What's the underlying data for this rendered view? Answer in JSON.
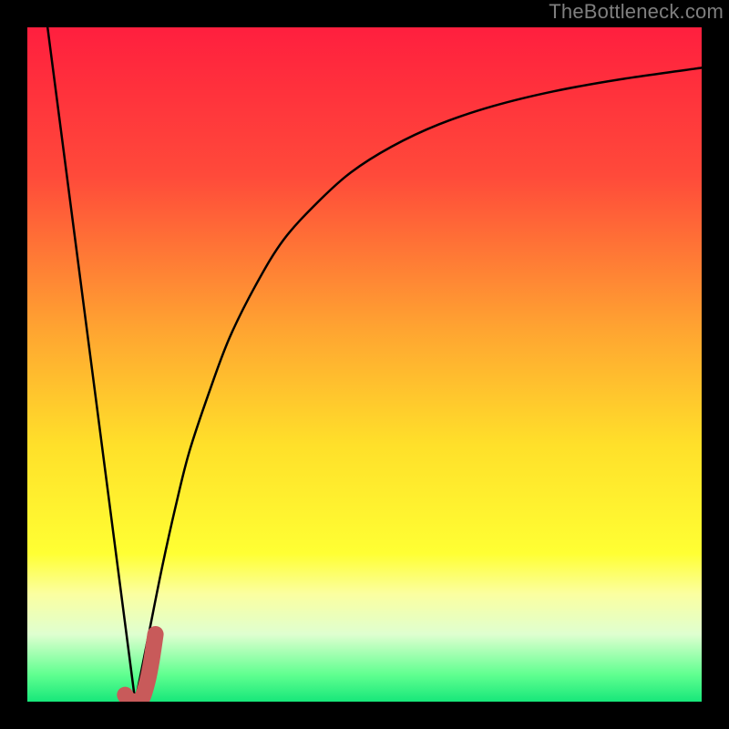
{
  "watermark": "TheBottleneck.com",
  "colors": {
    "frame": "#000000",
    "watermark": "#7f7f7f",
    "curve": "#000000",
    "marker": "#c85a5a",
    "gradient_stops": [
      {
        "y_pct": 0,
        "color": "#ff1f3e"
      },
      {
        "y_pct": 22,
        "color": "#ff4a3a"
      },
      {
        "y_pct": 45,
        "color": "#ffa531"
      },
      {
        "y_pct": 62,
        "color": "#ffe02a"
      },
      {
        "y_pct": 78,
        "color": "#ffff33"
      },
      {
        "y_pct": 84,
        "color": "#fbffa0"
      },
      {
        "y_pct": 90,
        "color": "#dfffd0"
      },
      {
        "y_pct": 96,
        "color": "#60ff90"
      },
      {
        "y_pct": 100,
        "color": "#17e77a"
      }
    ]
  },
  "chart_data": {
    "type": "line",
    "title": "",
    "xlabel": "",
    "ylabel": "",
    "xlim": [
      0,
      100
    ],
    "ylim": [
      0,
      100
    ],
    "grid": false,
    "legend": false,
    "series": [
      {
        "name": "left-slope",
        "x": [
          3.0,
          16.0
        ],
        "values": [
          100.0,
          0.0
        ]
      },
      {
        "name": "right-curve",
        "x": [
          16.0,
          18.0,
          20.0,
          22.0,
          24.0,
          27.0,
          30.0,
          34.0,
          38.0,
          43.0,
          48.0,
          54.0,
          61.0,
          69.0,
          78.0,
          88.0,
          100.0
        ],
        "values": [
          0.0,
          10.0,
          20.0,
          29.0,
          37.0,
          46.0,
          54.0,
          62.0,
          68.5,
          74.0,
          78.5,
          82.3,
          85.6,
          88.3,
          90.5,
          92.3,
          94.0
        ]
      }
    ],
    "marker": {
      "name": "highlight-hook",
      "x": [
        14.5,
        15.0,
        16.0,
        17.0,
        17.8,
        18.4,
        19.0
      ],
      "values": [
        1.0,
        0.3,
        0.0,
        0.5,
        3.0,
        6.0,
        10.0
      ],
      "stroke_width_px": 18,
      "color": "#c85a5a"
    }
  }
}
